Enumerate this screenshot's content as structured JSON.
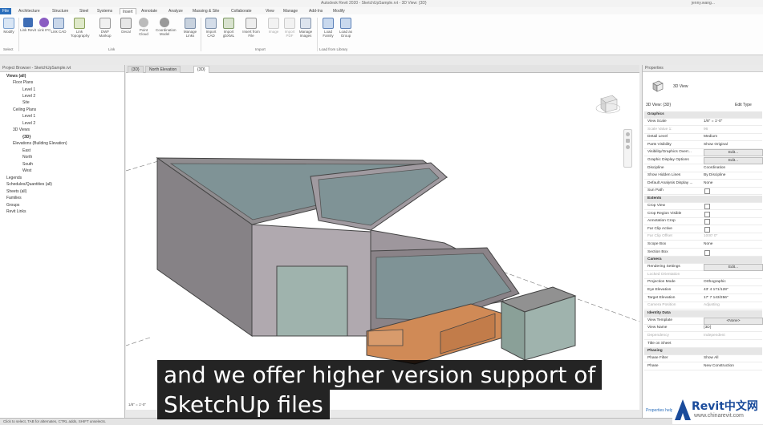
{
  "app": {
    "title": "Autodesk Revit 2020 - SketchUpSample.rvt - 3D View: {3D}",
    "user": "jenny.wang..."
  },
  "menu": {
    "tabs": [
      "File",
      "Architecture",
      "Structure",
      "Steel",
      "Systems",
      "Insert",
      "Annotate",
      "Analyze",
      "Massing & Site",
      "Collaborate",
      "View",
      "Manage",
      "Add-Ins",
      "Modify"
    ],
    "active": "Insert"
  },
  "ribbon": {
    "buttons": [
      "Modify",
      "Link Revit",
      "Link IFC",
      "Link CAD",
      "Link Topography",
      "DWF Markup",
      "Decal",
      "Point Cloud",
      "Coordination Model",
      "Manage Links",
      "Import CAD",
      "Import gbXML",
      "Insert from File",
      "Image",
      "Import PDF",
      "Manage Images",
      "Load Family",
      "Load as Group"
    ],
    "groups": [
      "Select",
      "Link",
      "Import",
      "Load from Library"
    ]
  },
  "browser": {
    "title": "Project Browser - SketchUpSample.rvt",
    "nodes": [
      "Views (all)",
      "Floor Plans",
      "Level 1",
      "Level 2",
      "Site",
      "Ceiling Plans",
      "Level 1",
      "Level 2",
      "3D Views",
      "{3D}",
      "Elevations (Building Elevation)",
      "East",
      "North",
      "South",
      "West",
      "Legends",
      "Schedules/Quantities (all)",
      "Sheets (all)",
      "Families",
      "Groups",
      "Revit Links"
    ]
  },
  "viewtabs": [
    "{3D}",
    "North Elevation",
    "{3D}"
  ],
  "view": {
    "scale": "1/8\" = 1'-0\""
  },
  "properties": {
    "title": "Properties",
    "type": "3D View",
    "instance": "3D View: {3D}",
    "edit_type": "Edit Type",
    "rows": [
      {
        "k": "Graphics",
        "sec": true
      },
      {
        "k": "View Scale",
        "v": "1/8\" = 1'-0\""
      },
      {
        "k": "Scale Value  1:",
        "v": "96",
        "grey": true
      },
      {
        "k": "Detail Level",
        "v": "Medium"
      },
      {
        "k": "Parts Visibility",
        "v": "Show Original"
      },
      {
        "k": "Visibility/Graphics Overr...",
        "btn": "Edit..."
      },
      {
        "k": "Graphic Display Options",
        "btn": "Edit..."
      },
      {
        "k": "Discipline",
        "v": "Coordination"
      },
      {
        "k": "Show Hidden Lines",
        "v": "By Discipline"
      },
      {
        "k": "Default Analysis Display ...",
        "v": "None"
      },
      {
        "k": "Sun Path",
        "cb": true
      },
      {
        "k": "Extents",
        "sec": true
      },
      {
        "k": "Crop View",
        "cb": true
      },
      {
        "k": "Crop Region Visible",
        "cb": true
      },
      {
        "k": "Annotation Crop",
        "cb": true
      },
      {
        "k": "Far Clip Active",
        "cb": true
      },
      {
        "k": "Far Clip Offset",
        "v": "1000' 0\"",
        "grey": true
      },
      {
        "k": "Scope Box",
        "v": "None"
      },
      {
        "k": "Section Box",
        "cb": true
      },
      {
        "k": "Camera",
        "sec": true
      },
      {
        "k": "Rendering Settings",
        "btn": "Edit..."
      },
      {
        "k": "Locked Orientation",
        "grey": true
      },
      {
        "k": "Projection Mode",
        "v": "Orthographic"
      },
      {
        "k": "Eye Elevation",
        "v": "43' 4 171/128\""
      },
      {
        "k": "Target Elevation",
        "v": "17' 7 143/256\""
      },
      {
        "k": "Camera Position",
        "v": "Adjusting",
        "grey": true
      },
      {
        "k": "Identity Data",
        "sec": true
      },
      {
        "k": "View Template",
        "btn": "<None>"
      },
      {
        "k": "View Name",
        "v": "{3D}"
      },
      {
        "k": "Dependency",
        "v": "Independent",
        "grey": true
      },
      {
        "k": "Title on Sheet"
      },
      {
        "k": "Phasing",
        "sec": true
      },
      {
        "k": "Phase Filter",
        "v": "Show All"
      },
      {
        "k": "Phase",
        "v": "New Construction"
      }
    ],
    "help": "Properties help"
  },
  "status": "Click to select, TAB for alternates, CTRL adds, SHIFT unselects.",
  "subtitle": {
    "line1": "and we offer higher version support of",
    "line2": "SketchUp files"
  },
  "watermark": {
    "brand": "Revit中文网",
    "url": "www.chinarevit.com"
  }
}
